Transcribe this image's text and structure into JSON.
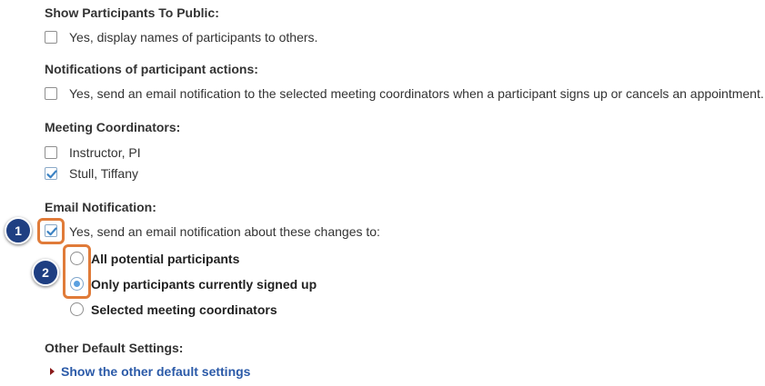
{
  "show_participants": {
    "heading": "Show Participants To Public:",
    "option": "Yes, display names of participants to others.",
    "checked": false
  },
  "notifications": {
    "heading": "Notifications of participant actions:",
    "option": "Yes, send an email notification to the selected meeting coordinators when a participant signs up or cancels an appointment.",
    "checked": false
  },
  "coordinators": {
    "heading": "Meeting Coordinators:",
    "items": [
      {
        "label": "Instructor, PI",
        "checked": false
      },
      {
        "label": "Stull, Tiffany",
        "checked": true
      }
    ]
  },
  "email_notification": {
    "heading": "Email Notification:",
    "option": "Yes, send an email notification about these changes to:",
    "checked": true,
    "recipients": [
      {
        "label": "All potential participants",
        "selected": false
      },
      {
        "label": "Only participants currently signed up",
        "selected": true
      },
      {
        "label": "Selected meeting coordinators",
        "selected": false
      }
    ]
  },
  "other_defaults": {
    "heading": "Other Default Settings:",
    "link": "Show the other default settings"
  },
  "callouts": [
    "1",
    "2"
  ],
  "colors": {
    "highlight": "#e07b39",
    "callout": "#1f3f82",
    "link": "#2b5aa8",
    "check": "#3b82c4",
    "radio_dot": "#5aa0e0"
  }
}
